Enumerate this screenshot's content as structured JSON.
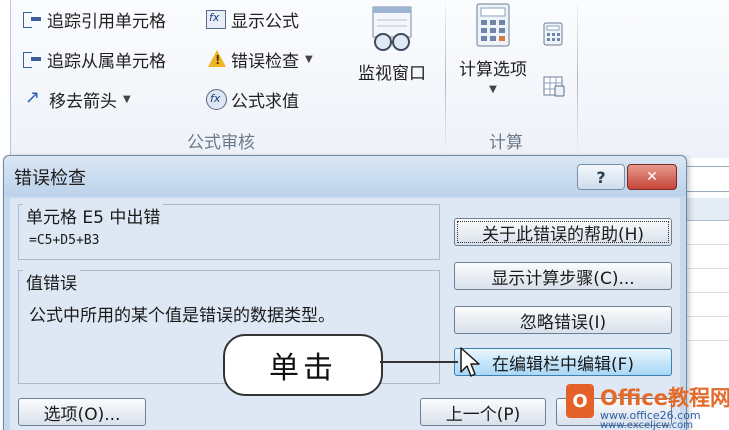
{
  "ribbon": {
    "trace_precedents": "追踪引用单元格",
    "trace_dependents": "追踪从属单元格",
    "remove_arrows": "移去箭头",
    "show_formulas": "显示公式",
    "error_checking": "错误检查",
    "evaluate_formula": "公式求值",
    "watch_window": "监视窗口",
    "calc_options": "计算选项",
    "group_auditing": "公式审核",
    "group_calculation": "计算"
  },
  "dialog": {
    "title": "错误检查",
    "help_glyph": "?",
    "close_glyph": "✕",
    "cell_error_label": "单元格 E5 中出错",
    "formula": "=C5+D5+B3",
    "error_type": "值错误",
    "error_description": "公式中所用的某个值是错误的数据类型。",
    "buttons": {
      "help_on_error": "关于此错误的帮助(H)",
      "show_calc_steps": "显示计算步骤(C)...",
      "ignore_error": "忽略错误(I)",
      "edit_in_formula_bar": "在编辑栏中编辑(F)",
      "options": "选项(O)...",
      "previous": "上一个(P)"
    }
  },
  "callout": {
    "text": "单击"
  },
  "watermark": {
    "logo_letter": "O",
    "title": "Office教程网",
    "url": "www.office26.com",
    "url2": "www.exceljcw.com"
  },
  "colors": {
    "dialog_frame": "#c4d8ee",
    "dialog_body": "#dde8f4",
    "close_button": "#c6463a",
    "hover_button": "#a9d8f6",
    "watermark_orange": "#e4622a"
  }
}
